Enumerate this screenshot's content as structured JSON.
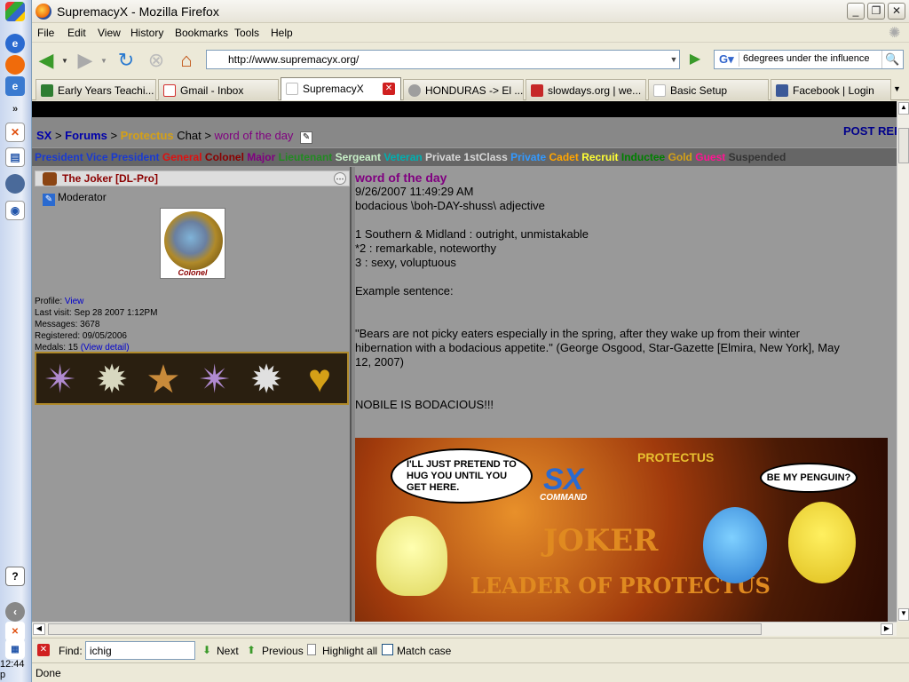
{
  "window": {
    "title": "SupremacyX - Mozilla Firefox"
  },
  "menu": [
    "File",
    "Edit",
    "View",
    "History",
    "Bookmarks",
    "Tools",
    "Help"
  ],
  "nav": {
    "url": "http://www.supremacyx.org/",
    "search_value": "6degrees under the influence"
  },
  "tabs": [
    {
      "label": "Early Years Teachi...",
      "color": "#2e7d32"
    },
    {
      "label": "Gmail - Inbox",
      "color": "#d32f2f"
    },
    {
      "label": "SupremacyX",
      "color": "#ffffff"
    },
    {
      "label": "HONDURAS -> El ...",
      "color": "#9e9e9e"
    },
    {
      "label": "slowdays.org | we...",
      "color": "#c62828"
    },
    {
      "label": "Basic Setup",
      "color": "#ffffff"
    },
    {
      "label": "Facebook | Login",
      "color": "#3b5998"
    }
  ],
  "breadcrumb": {
    "sx": "SX",
    "sep1": " > ",
    "forums": "Forums",
    "sep2": " > ",
    "group": "Protectus",
    "chat": " Chat",
    "sep3": " > ",
    "topic": "word of the day"
  },
  "post_reply": "POST REP",
  "ranks": [
    {
      "label": "President",
      "color": "#1a3ad0"
    },
    {
      "label": "Vice President",
      "color": "#1a3ad0"
    },
    {
      "label": "General",
      "color": "#e01010"
    },
    {
      "label": "Colonel",
      "color": "#8b0000"
    },
    {
      "label": "Major",
      "color": "#800080"
    },
    {
      "label": "Lieutenant",
      "color": "#228b22"
    },
    {
      "label": "Sergeant",
      "color": "#c8f0c8"
    },
    {
      "label": "Veteran",
      "color": "#00b0b0"
    },
    {
      "label": "Private 1stClass",
      "color": "#d8d8d8"
    },
    {
      "label": "Private",
      "color": "#3399ff"
    },
    {
      "label": "Cadet",
      "color": "#ffa500"
    },
    {
      "label": "Recruit",
      "color": "#ffff33"
    },
    {
      "label": "Inductee",
      "color": "#008000"
    },
    {
      "label": "Gold",
      "color": "#d4a017"
    },
    {
      "label": "Guest",
      "color": "#ff1493"
    },
    {
      "label": "Suspended",
      "color": "#333333"
    }
  ],
  "user": {
    "name": "The Joker [DL-Pro]",
    "role": "Moderator",
    "avatar_label": "Colonel",
    "profile_label": "Profile:",
    "profile_link": "View",
    "last_visit": "Last visit: Sep 28 2007 1:12PM",
    "messages": "Messages: 3678",
    "registered": "Registered: 09/05/2006",
    "medals_label": "Medals: 15",
    "medals_link": "(View detail)"
  },
  "post": {
    "title": "word of the day",
    "date": "9/26/2007 11:49:29 AM",
    "l1": "bodacious \\boh-DAY-shuss\\ adjective",
    "l2": "1 Southern & Midland : outright, unmistakable",
    "l3": "*2 : remarkable, noteworthy",
    "l4": "3 : sexy, voluptuous",
    "l5": "Example sentence:",
    "l6": "\"Bears are not picky eaters especially in the spring, after they wake up from their winter",
    "l7": "hibernation with a bodacious appetite.\" (George Osgood, Star-Gazette [Elmira, New York], May",
    "l8": "12, 2007)",
    "l9": "NOBILE IS BODACIOUS!!!"
  },
  "banner": {
    "bubble1": "I'LL JUST PRETEND TO HUG YOU UNTIL YOU GET HERE.",
    "bubble2": "BE MY PENGUIN?",
    "logo": "SX",
    "logo_sub": "COMMAND",
    "protectus": "PROTECTUS",
    "joker": "JOKER",
    "leader": "LEADER OF PROTECTUS"
  },
  "findbar": {
    "label": "Find:",
    "value": "ichig",
    "next": "Next",
    "previous": "Previous",
    "highlight": "Highlight all",
    "matchcase": "Match case"
  },
  "status": "Done",
  "clock": "12:44 p"
}
